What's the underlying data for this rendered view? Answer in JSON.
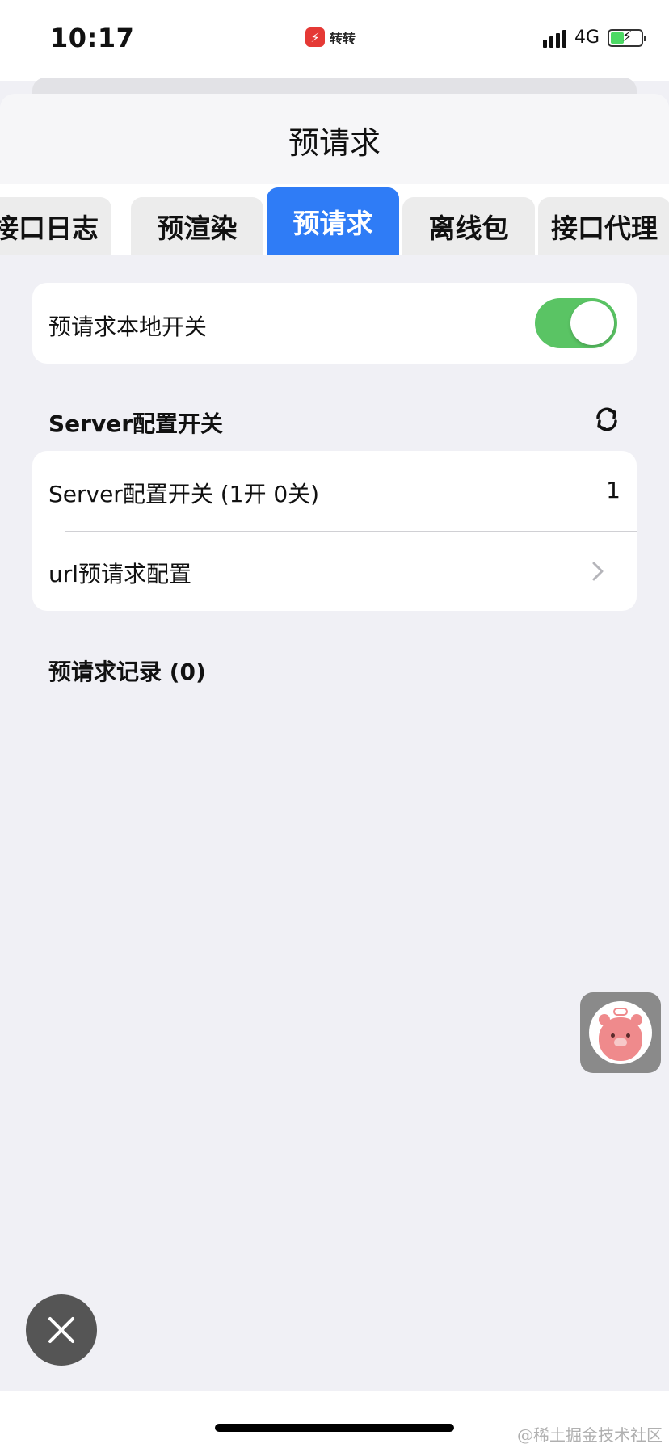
{
  "status_bar": {
    "time": "10:17",
    "app_name": "转转",
    "network": "4G"
  },
  "header": {
    "title": "预请求"
  },
  "tabs": [
    {
      "label": "接口日志",
      "active": false
    },
    {
      "label": "预渲染",
      "active": false
    },
    {
      "label": "预请求",
      "active": true
    },
    {
      "label": "离线包",
      "active": false
    },
    {
      "label": "接口代理",
      "active": false
    }
  ],
  "local_switch": {
    "label": "预请求本地开关",
    "enabled": true
  },
  "server_section": {
    "title": "Server配置开关",
    "rows": [
      {
        "label": "Server配置开关 (1开 0关)",
        "value": "1"
      },
      {
        "label": "url预请求配置"
      }
    ]
  },
  "records": {
    "title": "预请求记录 (0)"
  },
  "colors": {
    "active_tab": "#2f7cf6",
    "toggle_on": "#5ac464",
    "background": "#f0f0f5"
  },
  "icons": [
    "refresh-icon",
    "chevron-right-icon",
    "close-icon",
    "bear-avatar-icon",
    "battery-icon",
    "signal-icon"
  ],
  "watermark": "@稀土掘金技术社区"
}
